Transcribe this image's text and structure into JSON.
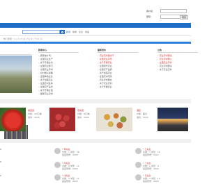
{
  "login": {
    "user_label": "用户名：",
    "pass_label": "密码：",
    "button": "登录"
  },
  "search": {
    "tabs": [
      "新闻",
      "供求",
      "企业",
      "商品"
    ],
    "subline": "热门搜索：1 | 2 | 3 | 4 | 5 | 6 | 7 | 8 | 9"
  },
  "columns": [
    {
      "title": "新闻中心",
      "items": [
        "国家统计局：",
        "全国农业生产",
        "关于开展全省",
        "全国农业部门",
        "全国农业农村",
        "乡村振兴战略",
        "全国种植业生",
        "关于加强农业",
        "全国农村集体",
        "全国农产品市",
        "关于开展全国",
        "国家农业农村",
        "全国农业技术",
        "关于加强农产"
      ]
    },
    {
      "title": "最新发布",
      "items": [
        "农业农村部关于",
        "全国农业农村",
        "关于开展农业",
        "全国现代农业",
        "全国农产品质",
        "关于加强农业",
        "全国农村宅基",
        "农业农村部办",
        "关于农业农村",
        "关于开展农业"
      ],
      "red_count": 3
    },
    {
      "title": "公告",
      "items": [
        "农业农村部关",
        "农业农村部公",
        "全国农业农村",
        "农业农村部关",
        "关于农业农村"
      ],
      "red_count": 3
    }
  ],
  "cards": [
    {
      "name": "番茄苗",
      "meta1": "价格：10元/株",
      "meta2": "发布：2024"
    },
    {
      "name": "荔枝苗",
      "meta1": "价格：8元/株",
      "meta2": "发布：2024"
    },
    {
      "name": "特色小吃",
      "meta1": "价格：面议",
      "meta2": "发布：2024"
    },
    {
      "name": "酒店",
      "meta1": "价格：面议",
      "meta2": "发布：2024"
    }
  ],
  "people": [
    {
      "name": "* 甲先生",
      "meta1": "文章：1 浏览：26",
      "meta2": "最后登录：2024"
    },
    {
      "name": "* 乙先生",
      "meta1": "文章：1 浏览：15",
      "meta2": "最后登录：2024"
    },
    {
      "name": "* 丙先生",
      "meta1": "文章：0 浏览：12",
      "meta2": "最后登录：2024"
    },
    {
      "name": "* 丁先生",
      "meta1": "文章：1 浏览：9",
      "meta2": "最后登录：2024"
    },
    {
      "name": "* 戊先生",
      "meta1": "文章：0 浏览：11",
      "meta2": "最后登录：2024"
    },
    {
      "name": "* 己先生",
      "meta1": "文章：2 浏览：13",
      "meta2": "最后登录：2024"
    }
  ]
}
